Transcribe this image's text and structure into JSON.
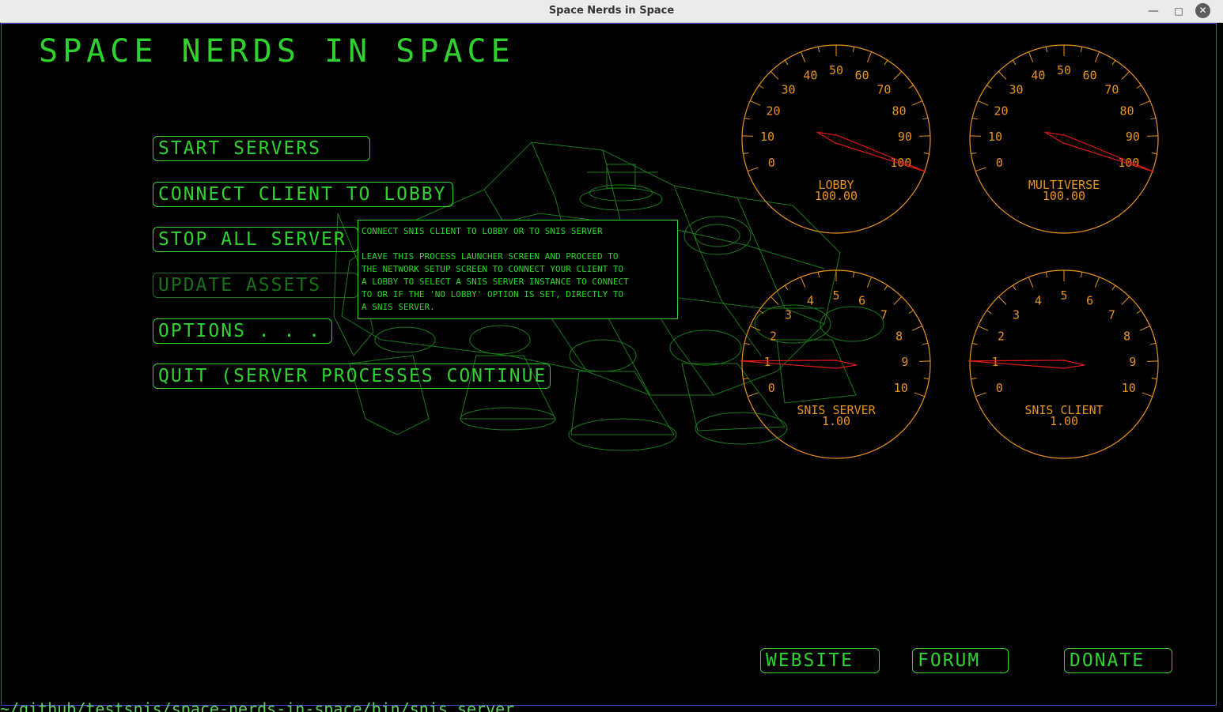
{
  "window": {
    "title": "Space Nerds in Space"
  },
  "game": {
    "title": "SPACE NERDS IN SPACE",
    "menu": [
      {
        "label": "START SERVERS",
        "disabled": false
      },
      {
        "label": "CONNECT CLIENT TO LOBBY",
        "disabled": false
      },
      {
        "label": "STOP ALL SERVER",
        "disabled": false
      },
      {
        "label": "UPDATE ASSETS",
        "disabled": true
      },
      {
        "label": "OPTIONS . . .",
        "disabled": false
      },
      {
        "label": "QUIT (SERVER PROCESSES CONTINUE)",
        "disabled": false
      }
    ],
    "tooltip": {
      "lines": [
        "CONNECT SNIS CLIENT TO LOBBY OR TO SNIS SERVER",
        "",
        "LEAVE THIS PROCESS LAUNCHER SCREEN AND PROCEED TO",
        "THE NETWORK SETUP SCREEN TO CONNECT YOUR CLIENT TO",
        "A LOBBY TO SELECT A SNIS SERVER INSTANCE TO CONNECT",
        "TO OR IF THE 'NO LOBBY' OPTION IS SET, DIRECTLY TO",
        "A SNIS SERVER."
      ]
    },
    "links": {
      "website": "WEBSITE",
      "forum": "FORUM",
      "donate": "DONATE"
    },
    "gauges": [
      {
        "id": "lobby",
        "label": "LOBBY",
        "readout": "100.00",
        "value": 100,
        "min": 0,
        "max": 100,
        "ticks": [
          "0",
          "10",
          "20",
          "30",
          "40",
          "50",
          "60",
          "70",
          "80",
          "90",
          "100"
        ]
      },
      {
        "id": "multiverse",
        "label": "MULTIVERSE",
        "readout": "100.00",
        "value": 100,
        "min": 0,
        "max": 100,
        "ticks": [
          "0",
          "10",
          "20",
          "30",
          "40",
          "50",
          "60",
          "70",
          "80",
          "90",
          "100"
        ]
      },
      {
        "id": "snis-server",
        "label": "SNIS SERVER",
        "readout": "1.00",
        "value": 1,
        "min": 0,
        "max": 10,
        "ticks": [
          "0",
          "1",
          "2",
          "3",
          "4",
          "5",
          "6",
          "7",
          "8",
          "9",
          "10"
        ]
      },
      {
        "id": "snis-client",
        "label": "SNIS CLIENT",
        "readout": "1.00",
        "value": 1,
        "min": 0,
        "max": 10,
        "ticks": [
          "0",
          "1",
          "2",
          "3",
          "4",
          "5",
          "6",
          "7",
          "8",
          "9",
          "10"
        ]
      }
    ],
    "colors": {
      "green": "#2fd22f",
      "dim_green": "#1c6e1c",
      "wireframe": "#1a7a1a",
      "gauge": "#e8931a",
      "needle": "#e01818"
    }
  },
  "terminal": {
    "text": "~/github/testsnis/space-nerds-in-space/bin/snis_server"
  }
}
